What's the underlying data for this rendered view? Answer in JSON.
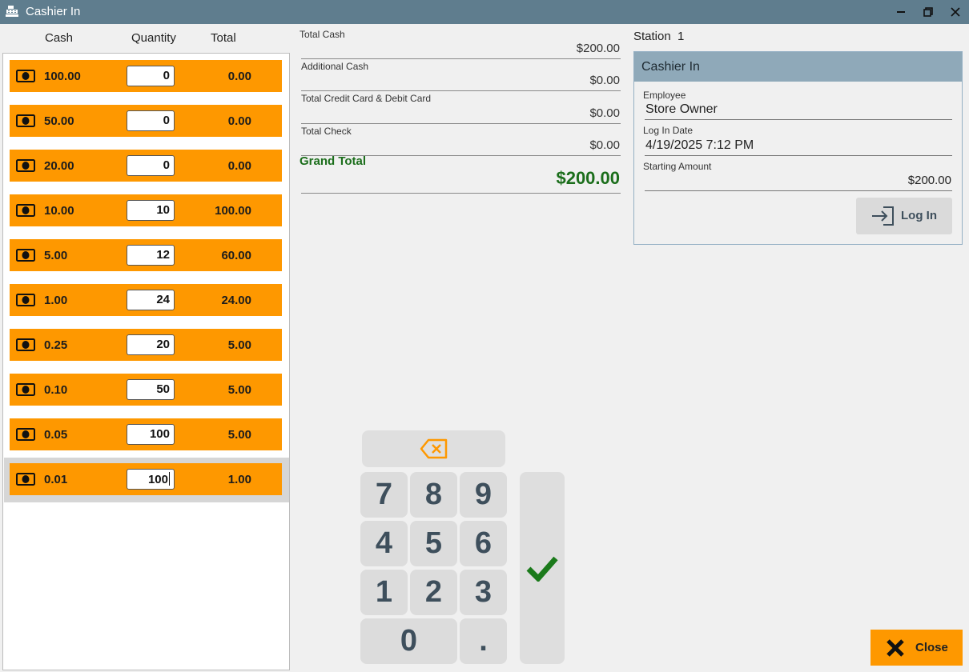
{
  "window": {
    "title": "Cashier In"
  },
  "grid": {
    "headers": {
      "cash": "Cash",
      "quantity": "Quantity",
      "total": "Total"
    },
    "rows": [
      {
        "denom": "100.00",
        "qty": "0",
        "total": "0.00"
      },
      {
        "denom": "50.00",
        "qty": "0",
        "total": "0.00"
      },
      {
        "denom": "20.00",
        "qty": "0",
        "total": "0.00"
      },
      {
        "denom": "10.00",
        "qty": "10",
        "total": "100.00"
      },
      {
        "denom": "5.00",
        "qty": "12",
        "total": "60.00"
      },
      {
        "denom": "1.00",
        "qty": "24",
        "total": "24.00"
      },
      {
        "denom": "0.25",
        "qty": "20",
        "total": "5.00"
      },
      {
        "denom": "0.10",
        "qty": "50",
        "total": "5.00"
      },
      {
        "denom": "0.05",
        "qty": "100",
        "total": "5.00"
      },
      {
        "denom": "0.01",
        "qty": "100",
        "total": "1.00"
      }
    ],
    "selected_row": 9
  },
  "summary": {
    "total_cash": {
      "label": "Total Cash",
      "value": "$200.00"
    },
    "additional_cash": {
      "label": "Additional Cash",
      "value": "$0.00"
    },
    "card": {
      "label": "Total Credit Card & Debit Card",
      "value": "$0.00"
    },
    "check": {
      "label": "Total Check",
      "value": "$0.00"
    },
    "grand_total": {
      "label": "Grand Total",
      "value": "$200.00"
    }
  },
  "keypad": {
    "keys": [
      "7",
      "8",
      "9",
      "4",
      "5",
      "6",
      "1",
      "2",
      "3",
      "0",
      "."
    ],
    "backspace_icon": "backspace-icon",
    "enter_icon": "checkmark-icon"
  },
  "station": {
    "label": "Station",
    "number": "1",
    "panel_title": "Cashier In",
    "employee_label": "Employee",
    "employee": "Store Owner",
    "login_date_label": "Log In Date",
    "login_date": "4/19/2025 7:12 PM",
    "starting_amount_label": "Starting Amount",
    "starting_amount": "$200.00",
    "login_button": "Log In"
  },
  "close_button": "Close",
  "colors": {
    "titlebar": "#5f7d8e",
    "accent": "#fe9800",
    "grand_total": "#1b6e1b",
    "panel_header": "#8fa9b9"
  }
}
